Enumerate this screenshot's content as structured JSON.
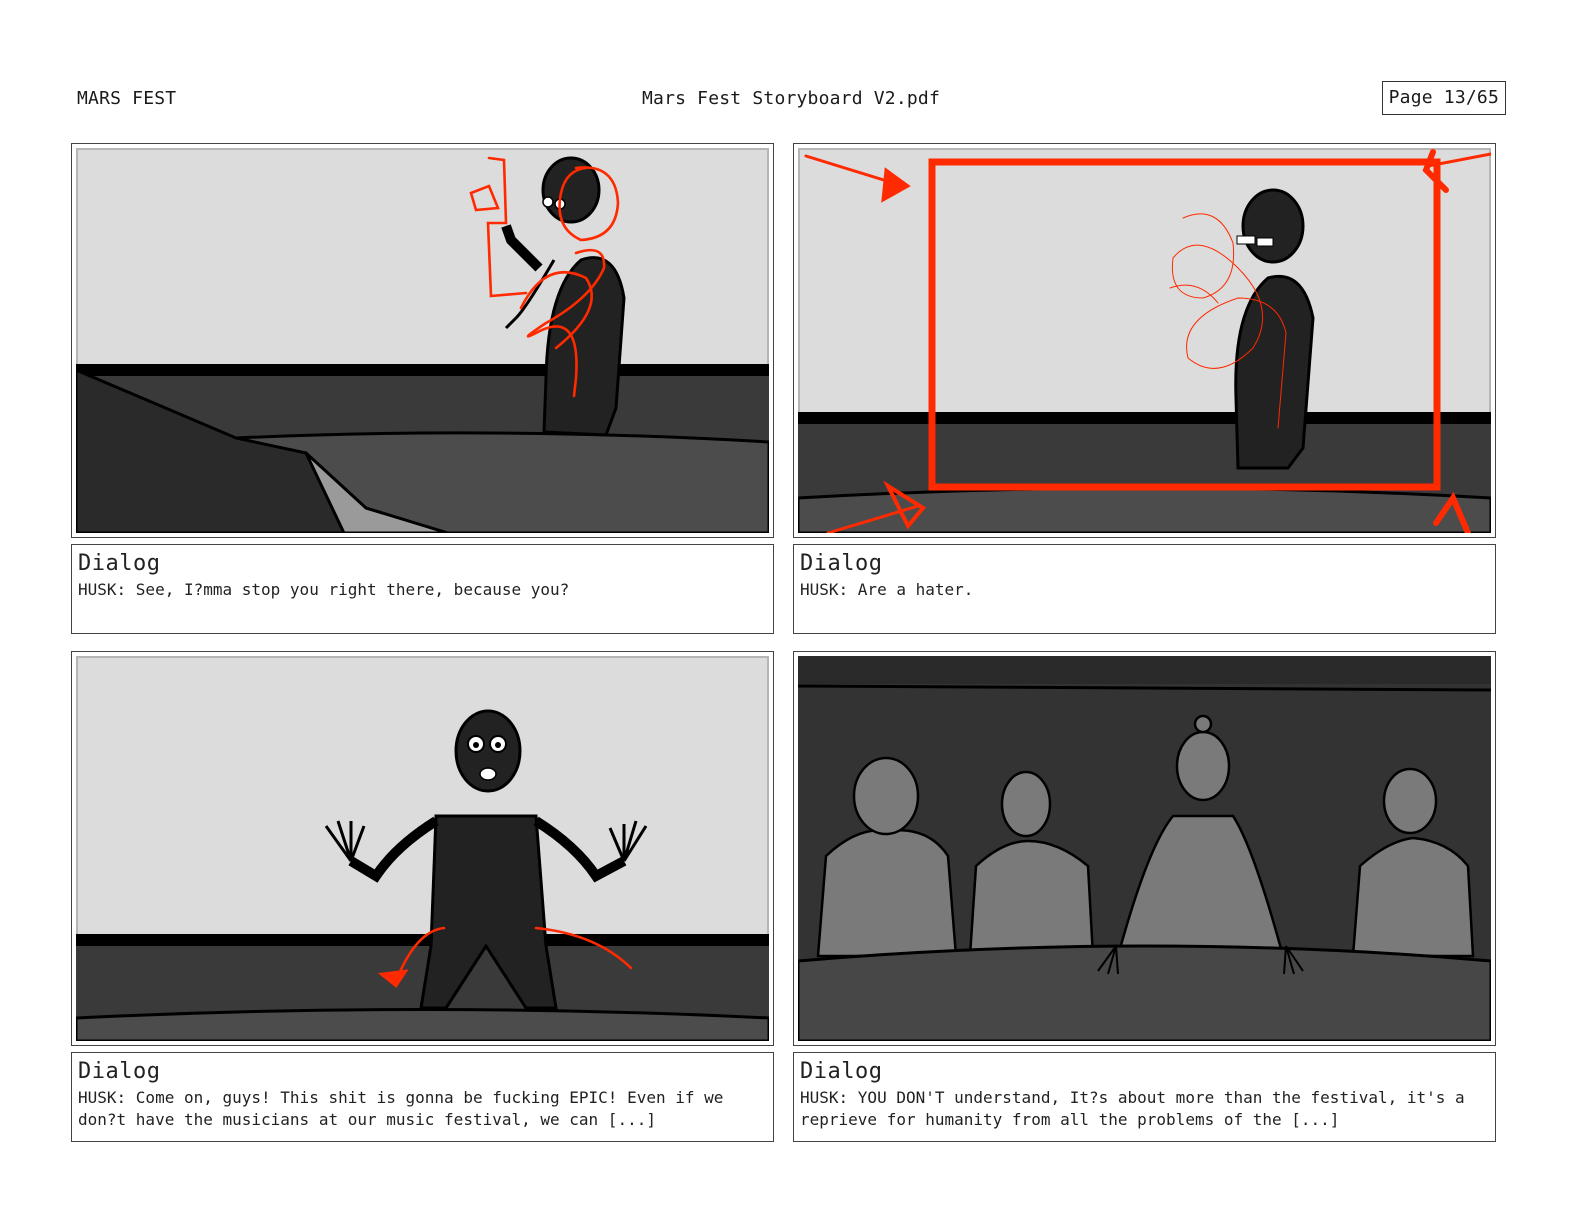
{
  "header": {
    "doc_title": "MARS FEST",
    "file_name": "Mars Fest Storyboard V2.pdf",
    "page": "Page 13/65"
  },
  "colors": {
    "sketch_red": "#ff2a00",
    "wall": "#dcdcdc",
    "dark_grey": "#3a3a3a"
  },
  "panels": [
    {
      "label": "Dialog",
      "text": "HUSK: See, I?mma stop you right there, because you?"
    },
    {
      "label": "Dialog",
      "text": "HUSK: Are a hater."
    },
    {
      "label": "Dialog",
      "text": "HUSK: Come on, guys! This shit is gonna be fucking EPIC! Even if we don?t have the musicians at our music festival, we can [...]"
    },
    {
      "label": "Dialog",
      "text": "HUSK:  YOU DON'T understand, It?s about more than the festival, it's a reprieve for humanity from all the problems of the [...]"
    }
  ]
}
